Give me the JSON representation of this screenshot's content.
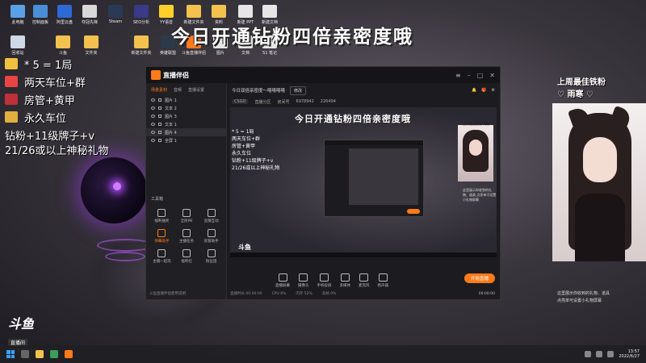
{
  "banner": "今日开通钻粉四倍亲密度哦",
  "perks": [
    {
      "icon": "ticket-icon",
      "color": "#f0c040",
      "text": "* 5 = 1局"
    },
    {
      "icon": "car-icon",
      "color": "#e94444",
      "text": "两天车位+群"
    },
    {
      "icon": "sword-icon",
      "color": "#c0303a",
      "text": "房管+黄甲"
    },
    {
      "icon": "card-icon",
      "color": "#e0b040",
      "text": "永久车位"
    }
  ],
  "perk_lines": [
    "钻粉+11级牌子+v",
    "21/26或以上神秘礼物"
  ],
  "desktop_icons": [
    {
      "label": "此电脑",
      "color": "#5aa0e6"
    },
    {
      "label": "控制面板",
      "color": "#4a8fd6"
    },
    {
      "label": "阿里云盘",
      "color": "#2d6ad6"
    },
    {
      "label": "夺冠先锋",
      "color": "#d8d8d8"
    },
    {
      "label": "Steam",
      "color": "#2a3a55"
    },
    {
      "label": "SEO分析",
      "color": "#3a3a88"
    },
    {
      "label": "YY语音",
      "color": "#ffd02a"
    },
    {
      "label": "新建文件夹",
      "color": "#f2c14e"
    },
    {
      "label": "资料",
      "color": "#f2c14e"
    },
    {
      "label": "新建 PPT",
      "color": "#e6e6e6"
    },
    {
      "label": "新建文档",
      "color": "#e6e6e6"
    },
    {
      "label": "回收站",
      "color": "#cfd8e6"
    },
    {
      "label": "斗鱼",
      "color": "#f2c14e"
    },
    {
      "label": "文件夹",
      "color": "#f2c14e"
    },
    {
      "label": "新建文件夹",
      "color": "#f2c14e"
    },
    {
      "label": "英雄联盟",
      "color": "#2d3a4a"
    },
    {
      "label": "斗鱼直播伴侣",
      "color": "#ff7a1a"
    },
    {
      "label": "图片",
      "color": "#e6e6e6"
    },
    {
      "label": "文档",
      "color": "#e6e6e6"
    },
    {
      "label": "S1 笔记",
      "color": "#e6e6e6"
    }
  ],
  "app": {
    "name": "直播伴侣",
    "tabs": [
      "场景素材",
      "音频",
      "直播设置"
    ],
    "sources": [
      "图片 1",
      "文本 2",
      "图片 3",
      "文本 1",
      "图片 4",
      "全屏 1"
    ],
    "tools_header": "工具箱",
    "tools": [
      {
        "label": "福利抽奖",
        "hot": false
      },
      {
        "label": "全民PK",
        "hot": false
      },
      {
        "label": "竞猜互动",
        "hot": false
      },
      {
        "label": "弹幕助手",
        "hot": true
      },
      {
        "label": "主播任务",
        "hot": false
      },
      {
        "label": "房管助手",
        "hot": false
      },
      {
        "label": "主播一起玩",
        "hot": false
      },
      {
        "label": "福利社",
        "hot": false
      },
      {
        "label": "粉丝团",
        "hot": false
      }
    ],
    "footer": "斗鱼直播伴侣使用说明",
    "room_title": "今日双倍亲密度～嘻嘻嘻嘻",
    "edit_label": "修改",
    "room_meta": [
      "CSGO",
      "直播分区",
      "房间号",
      "6978942",
      "226494"
    ],
    "preview": {
      "banner": "今日开通钻粉四倍亲密度哦",
      "perk_lines": [
        "* 5 = 1局",
        "两天车位+群",
        "房管+黄甲",
        "永久车位",
        "钻粉+11级牌子+v",
        "21/26或以上神秘礼物"
      ],
      "girl_label": "上周最佳铁粉 雨寒",
      "caption": "这里展示你收到的礼物、道具 点亮单可设置小礼物屏幕"
    },
    "controls": [
      "直播屏幕",
      "摄像头",
      "手机投屏",
      "多媒体",
      "麦克风",
      "扬声器"
    ],
    "go_live": "开始直播",
    "status": [
      "直播时长 00:00:00",
      "CPU 8%",
      "内存 52%",
      "丢帧 0%"
    ],
    "rec_time": "00:00:00"
  },
  "rank": {
    "title": "上周最佳铁粉",
    "name": "♡ 雨寒 ♡"
  },
  "note": [
    "这里展示你收到的礼物、道具",
    "点亮单可设置小礼物屏幕"
  ],
  "douyu": {
    "brand": "斗鱼",
    "sub": "直播间",
    "room_id": "6978942"
  },
  "clock": {
    "time": "13:57",
    "date": "2022/6/27"
  }
}
